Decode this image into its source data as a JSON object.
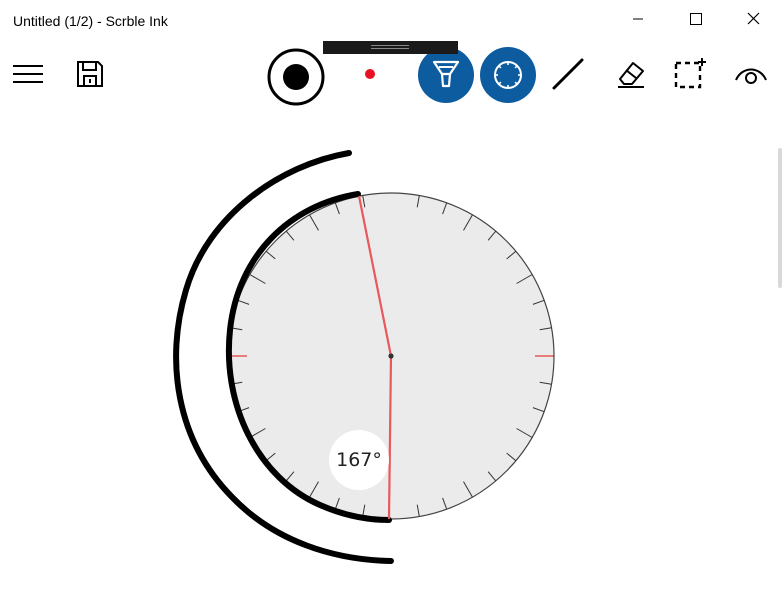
{
  "window": {
    "title": "Untitled (1/2) - Scrble Ink",
    "minimize_icon": "minimize-icon",
    "maximize_icon": "maximize-icon",
    "close_icon": "close-icon"
  },
  "toolbar": {
    "items": [
      {
        "name": "hamburger-menu",
        "icon": "hamburger-icon"
      },
      {
        "name": "save",
        "icon": "floppy-disk-icon"
      },
      {
        "name": "pen-size",
        "icon": "pen-size-icon"
      },
      {
        "name": "pen-color",
        "icon": "color-dot-icon",
        "color": "#e81123"
      },
      {
        "name": "highlighter",
        "icon": "highlighter-icon",
        "active": true
      },
      {
        "name": "protractor",
        "icon": "protractor-icon",
        "active": true
      },
      {
        "name": "ruler-line",
        "icon": "line-icon"
      },
      {
        "name": "eraser",
        "icon": "eraser-icon"
      },
      {
        "name": "selection",
        "icon": "lasso-select-icon"
      },
      {
        "name": "view",
        "icon": "eye-icon"
      }
    ],
    "active_color": "#0e5ca0"
  },
  "protractor": {
    "angle_label": "167°",
    "marker_color": "#e8595b",
    "face_color": "#ebebeb"
  },
  "colors": {
    "background": "#ffffff",
    "ink": "#000000"
  }
}
